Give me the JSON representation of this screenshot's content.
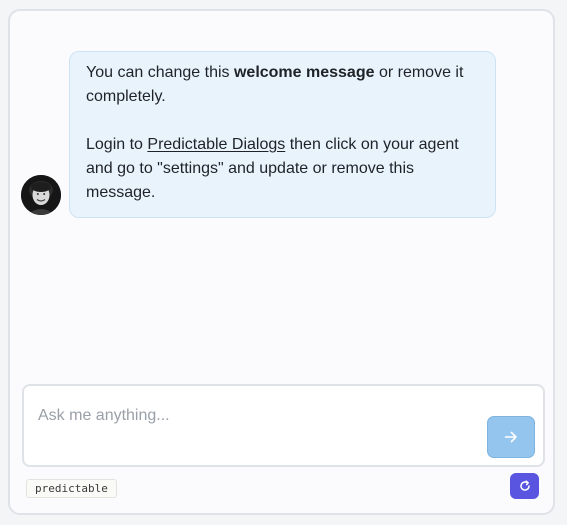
{
  "chat": {
    "message": {
      "line1_pre": "You can change this ",
      "line1_bold": "welcome message",
      "line1_post": " or remove it completely.",
      "line2_pre": "Login to ",
      "line2_link": "Predictable Dialogs",
      "line2_post": " then click on your agent and go to \"settings\" and update or remove this message."
    },
    "avatar_icon": "agent-avatar"
  },
  "composer": {
    "placeholder": "Ask me anything...",
    "send_icon": "arrow-right-icon"
  },
  "footer": {
    "badge": "predictable",
    "refresh_icon": "refresh-icon"
  },
  "colors": {
    "bubble_bg": "#e8f3fc",
    "send_button": "#93c5ee",
    "refresh_button": "#5a55e0"
  }
}
